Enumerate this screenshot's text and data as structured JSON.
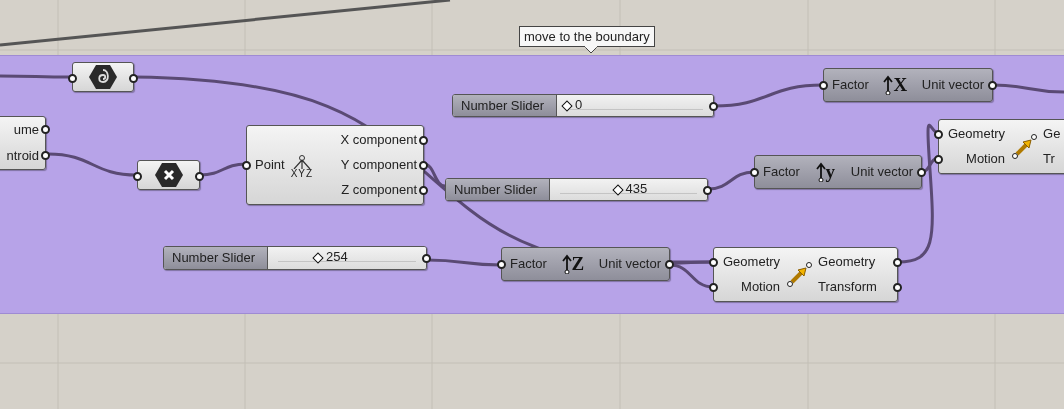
{
  "group": {
    "label": "move to the boundary"
  },
  "nodes": [
    {
      "kind": "partial",
      "outputs": [
        "ume",
        "ntroid"
      ]
    },
    {
      "kind": "icon"
    },
    {
      "kind": "icon"
    },
    {
      "kind": "deconstruct",
      "input": "Point",
      "icon_text": "XYZ",
      "outputs": [
        "X component",
        "Y component",
        "Z component"
      ]
    },
    {
      "kind": "slider",
      "label": "Number Slider",
      "value": "0",
      "level": 0
    },
    {
      "kind": "unit",
      "input": "Factor",
      "axis": "X",
      "output": "Unit vector"
    },
    {
      "kind": "move",
      "inputs": [
        "Geometry",
        "Motion"
      ],
      "outputs": [
        "Ge",
        "Tr"
      ]
    },
    {
      "kind": "slider",
      "label": "Number Slider",
      "value": "435",
      "level": 0.42
    },
    {
      "kind": "unit",
      "input": "Factor",
      "axis": "y",
      "output": "Unit vector"
    },
    {
      "kind": "slider",
      "label": "Number Slider",
      "value": "254",
      "level": 0.29
    },
    {
      "kind": "unit",
      "input": "Factor",
      "axis": "Z",
      "output": "Unit vector"
    },
    {
      "kind": "move",
      "inputs": [
        "Geometry",
        "Motion"
      ],
      "outputs": [
        "Geometry",
        "Transform"
      ]
    }
  ]
}
